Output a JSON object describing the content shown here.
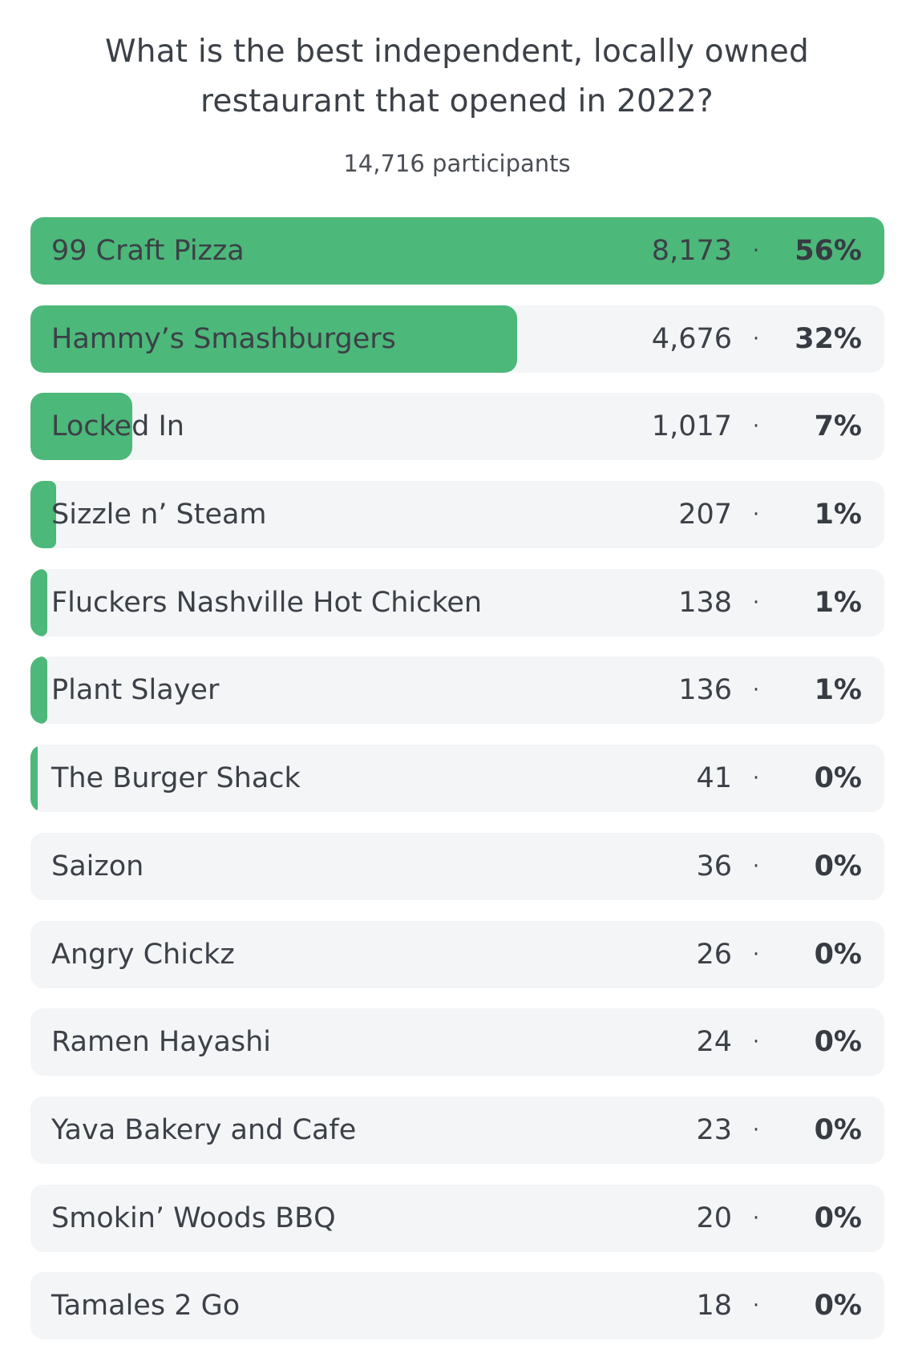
{
  "poll": {
    "title_lines": [
      "What is the best independent, locally owned",
      "restaurant that opened in 2022?"
    ],
    "participants": "14,716 participants",
    "colors": {
      "fill": "#4cb87a",
      "track": "#f3f5f7",
      "text": "#3c4047"
    },
    "separator": "·",
    "options": [
      {
        "label": "99 Craft Pizza",
        "votes": "8,173",
        "percent": "56%",
        "fill_fraction": 1.0
      },
      {
        "label": "Hammy’s Smashburgers",
        "votes": "4,676",
        "percent": "32%",
        "fill_fraction": 0.57
      },
      {
        "label": "Locked In",
        "votes": "1,017",
        "percent": "7%",
        "fill_fraction": 0.119
      },
      {
        "label": "Sizzle n’ Steam",
        "votes": "207",
        "percent": "1%",
        "fill_fraction": 0.03
      },
      {
        "label": "Fluckers Nashville Hot Chicken",
        "votes": "138",
        "percent": "1%",
        "fill_fraction": 0.02
      },
      {
        "label": "Plant Slayer",
        "votes": "136",
        "percent": "1%",
        "fill_fraction": 0.02
      },
      {
        "label": "The Burger Shack",
        "votes": "41",
        "percent": "0%",
        "fill_fraction": 0.008
      },
      {
        "label": "Saizon",
        "votes": "36",
        "percent": "0%",
        "fill_fraction": 0
      },
      {
        "label": "Angry Chickz",
        "votes": "26",
        "percent": "0%",
        "fill_fraction": 0
      },
      {
        "label": "Ramen Hayashi",
        "votes": "24",
        "percent": "0%",
        "fill_fraction": 0
      },
      {
        "label": "Yava Bakery and Cafe",
        "votes": "23",
        "percent": "0%",
        "fill_fraction": 0
      },
      {
        "label": "Smokin’ Woods BBQ",
        "votes": "20",
        "percent": "0%",
        "fill_fraction": 0
      },
      {
        "label": "Tamales 2 Go",
        "votes": "18",
        "percent": "0%",
        "fill_fraction": 0
      }
    ]
  }
}
